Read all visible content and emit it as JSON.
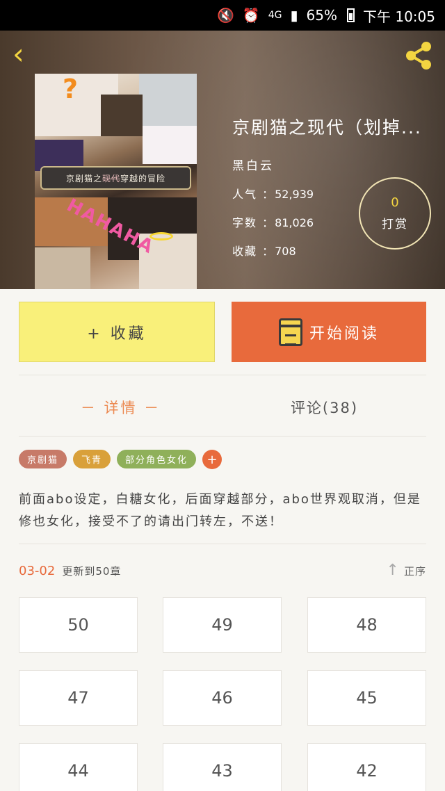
{
  "status_bar": {
    "signal_label": "4G",
    "battery": "65%",
    "time": "下午 10:05",
    "icons": [
      "mute-icon",
      "alarm-icon",
      "signal-icon",
      "battery-icon"
    ]
  },
  "header": {
    "back_icon": "back-arrow-icon",
    "share_icon": "share-icon"
  },
  "book": {
    "cover_banner": {
      "before": "京剧猫之",
      "struck": "现代",
      "after": "穿越的冒险"
    },
    "title": "京剧猫之现代（划掉...",
    "author": "黑白云",
    "stats": [
      {
        "label": "人气",
        "value": "52,939"
      },
      {
        "label": "字数",
        "value": "81,026"
      },
      {
        "label": "收藏",
        "value": "708"
      }
    ],
    "reward": {
      "count": "0",
      "label": "打赏"
    }
  },
  "actions": {
    "collect_label": "+ 收藏",
    "read_label": "开始阅读"
  },
  "tabs": {
    "detail_label": "－ 详情 －",
    "comments_label": "评论(38)"
  },
  "tags": [
    {
      "label": "京剧猫",
      "color": "#c77a68"
    },
    {
      "label": "飞青",
      "color": "#d9a03a"
    },
    {
      "label": "部分角色女化",
      "color": "#8fb05a"
    }
  ],
  "description": "前面abo设定，白糖女化，后面穿越部分，abo世界观取消，但是修也女化，接受不了的请出门转左，不送！",
  "updates": {
    "date": "03-02",
    "text": "更新到50章",
    "sort_label": "正序"
  },
  "chapters": [
    "50",
    "49",
    "48",
    "47",
    "46",
    "45",
    "44",
    "43",
    "42"
  ],
  "colors": {
    "accent_orange": "#e86a3c",
    "collect_yellow": "#f9f07a",
    "title_yellow": "#f3d541"
  }
}
